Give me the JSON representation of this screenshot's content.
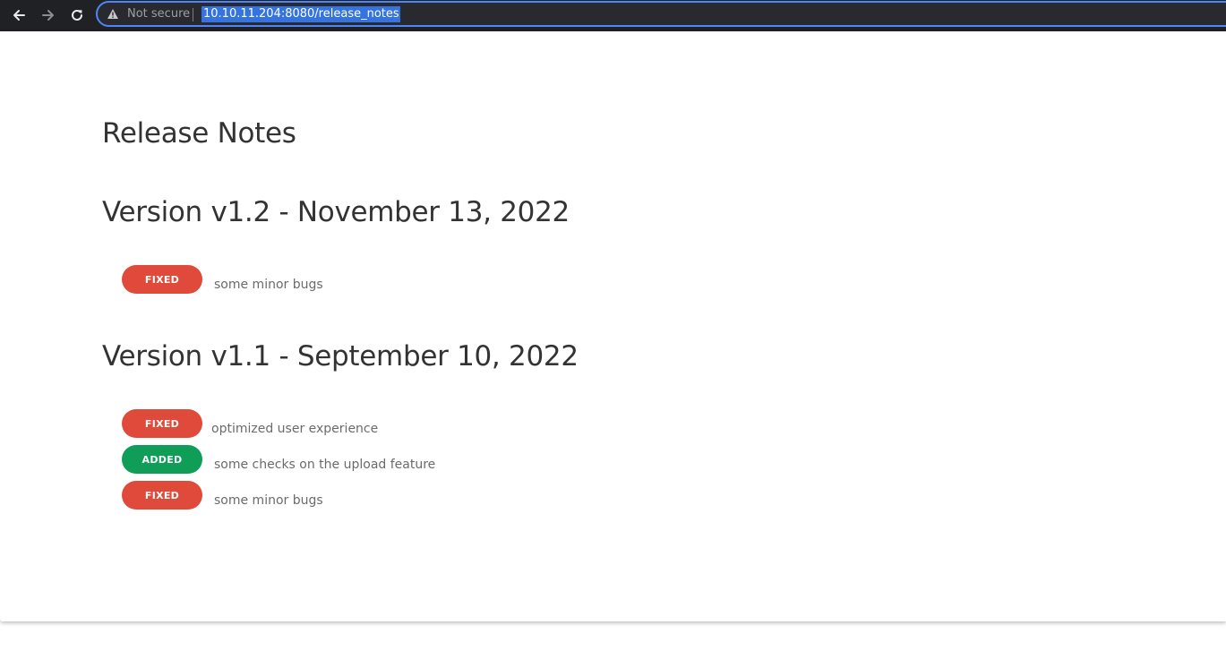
{
  "browser": {
    "security_label": "Not secure",
    "url": "10.10.11.204:8080/release_notes"
  },
  "page": {
    "title": "Release Notes",
    "versions": [
      {
        "title": "Version v1.2 - November 13, 2022",
        "notes": [
          {
            "tag": "FIXED",
            "text": "some minor bugs",
            "color": "#e04a3a"
          }
        ]
      },
      {
        "title": "Version v1.1 - September 10, 2022",
        "notes": [
          {
            "tag": "FIXED",
            "text": "optimized user experience",
            "color": "#e04a3a"
          },
          {
            "tag": "ADDED",
            "text": "some checks on the upload feature",
            "color": "#0f9d58"
          },
          {
            "tag": "FIXED",
            "text": "some minor bugs",
            "color": "#e04a3a"
          }
        ]
      }
    ]
  }
}
